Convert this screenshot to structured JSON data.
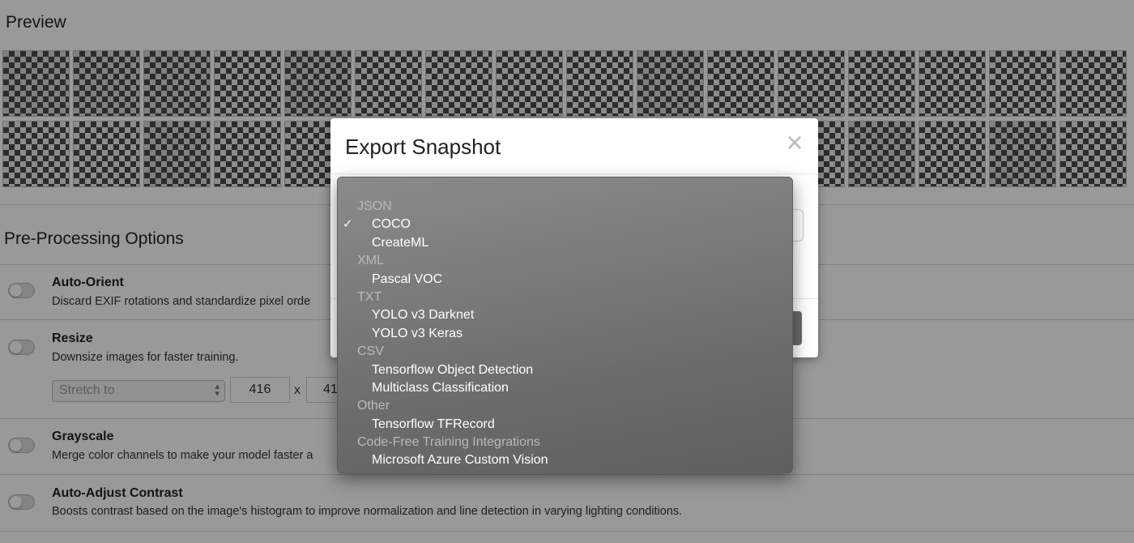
{
  "page": {
    "preview_title": "Preview",
    "preprocessing_title": "Pre-Processing Options"
  },
  "options": {
    "auto_orient": {
      "title": "Auto-Orient",
      "description": "Discard EXIF rotations and standardize pixel orde"
    },
    "resize": {
      "title": "Resize",
      "description": "Downsize images for faster training.",
      "mode": "Stretch to",
      "width": "416",
      "times": "x",
      "height": "41"
    },
    "grayscale": {
      "title": "Grayscale",
      "description": "Merge color channels to make your model faster a"
    },
    "auto_adjust_contrast": {
      "title": "Auto-Adjust Contrast",
      "description": "Boosts contrast based on the image's histogram to improve normalization and line detection in varying lighting conditions."
    }
  },
  "modal": {
    "title": "Export Snapshot",
    "close_icon": "close-icon"
  },
  "format_menu": {
    "selected": "COCO",
    "groups": [
      {
        "label": "JSON",
        "items": [
          "COCO",
          "CreateML"
        ]
      },
      {
        "label": "XML",
        "items": [
          "Pascal VOC"
        ]
      },
      {
        "label": "TXT",
        "items": [
          "YOLO v3 Darknet",
          "YOLO v3 Keras"
        ]
      },
      {
        "label": "CSV",
        "items": [
          "Tensorflow Object Detection",
          "Multiclass Classification"
        ]
      },
      {
        "label": "Other",
        "items": [
          "Tensorflow TFRecord"
        ]
      },
      {
        "label": "Code-Free Training Integrations",
        "items": [
          "Microsoft Azure Custom Vision"
        ]
      }
    ]
  },
  "colors": {
    "menu_background": "#7b7b7b",
    "menu_item_text": "#ffffff",
    "menu_group_text": "#b9b9b9"
  }
}
